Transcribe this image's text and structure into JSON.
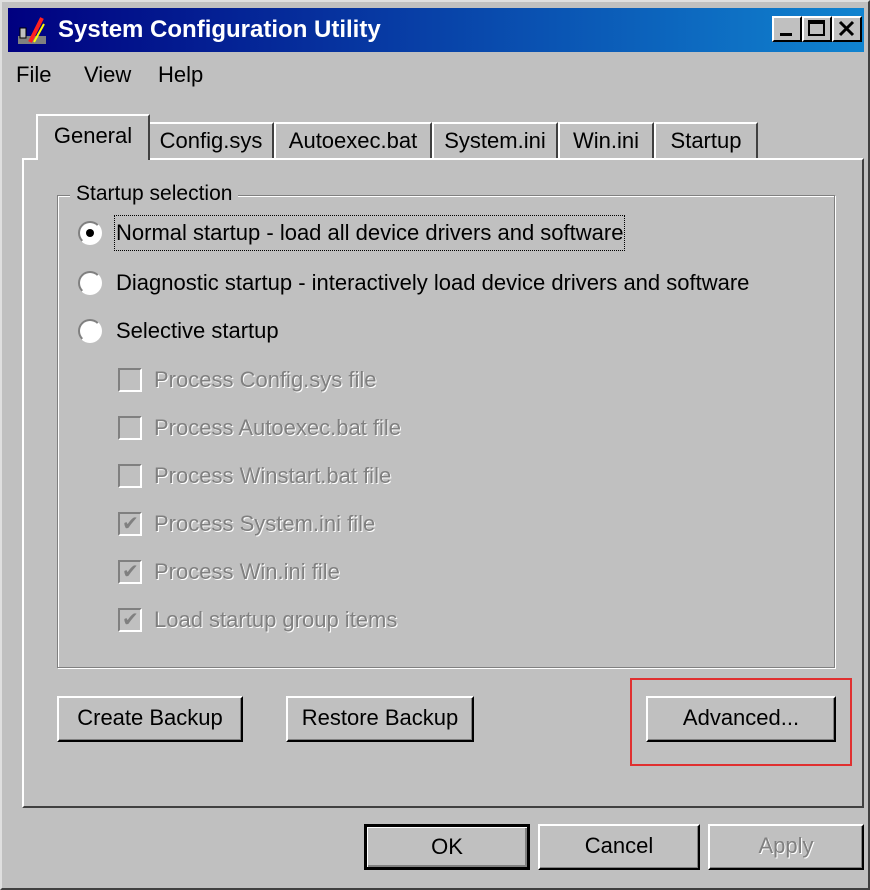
{
  "window": {
    "title": "System Configuration Utility",
    "app_icon": "msconfig-icon",
    "controls": [
      "minimize-icon",
      "maximize-icon",
      "close-icon"
    ]
  },
  "menu": {
    "file": "File",
    "view": "View",
    "help": "Help"
  },
  "tabs": [
    {
      "label": "General",
      "active": true
    },
    {
      "label": "Config.sys",
      "active": false
    },
    {
      "label": "Autoexec.bat",
      "active": false
    },
    {
      "label": "System.ini",
      "active": false
    },
    {
      "label": "Win.ini",
      "active": false
    },
    {
      "label": "Startup",
      "active": false
    }
  ],
  "startup_selection": {
    "legend": "Startup selection",
    "options": [
      {
        "label": "Normal startup - load all device drivers and software",
        "selected": true
      },
      {
        "label": "Diagnostic startup - interactively load device drivers and software",
        "selected": false
      },
      {
        "label": "Selective startup",
        "selected": false
      }
    ],
    "checkboxes": [
      {
        "label": "Process Config.sys file",
        "checked": false,
        "enabled": false
      },
      {
        "label": "Process Autoexec.bat file",
        "checked": false,
        "enabled": false
      },
      {
        "label": "Process Winstart.bat file",
        "checked": false,
        "enabled": false
      },
      {
        "label": "Process System.ini file",
        "checked": true,
        "enabled": false
      },
      {
        "label": "Process Win.ini file",
        "checked": true,
        "enabled": false
      },
      {
        "label": "Load startup group items",
        "checked": true,
        "enabled": false
      }
    ]
  },
  "buttons": {
    "create_backup": "Create Backup",
    "restore_backup": "Restore Backup",
    "advanced": "Advanced...",
    "ok": "OK",
    "cancel": "Cancel",
    "apply": "Apply"
  },
  "colors": {
    "window_bg": "#c0c0c0",
    "titlebar_start": "#000080",
    "titlebar_end": "#1084d0",
    "highlight": "#e03030",
    "disabled_text": "#808080"
  }
}
